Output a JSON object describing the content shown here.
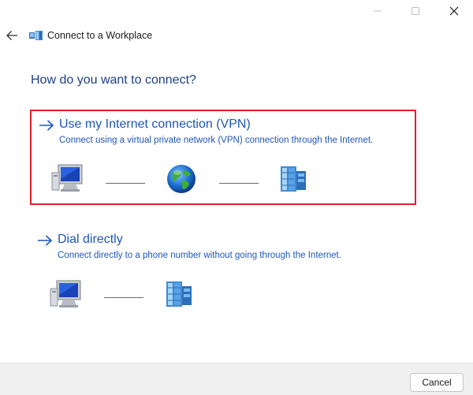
{
  "window": {
    "title": "Connect to a Workplace",
    "controls": [
      "minimize",
      "maximize",
      "close"
    ]
  },
  "header": {
    "back_icon": "back-arrow-icon",
    "app_icon": "workplace-network-icon",
    "title": "Connect to a Workplace"
  },
  "main": {
    "heading": "How do you want to connect?",
    "options": [
      {
        "title": "Use my Internet connection (VPN)",
        "description": "Connect using a virtual private network (VPN) connection through the Internet.",
        "icons": [
          "computer-icon",
          "globe-icon",
          "server-icon"
        ],
        "highlighted": true
      },
      {
        "title": "Dial directly",
        "description": "Connect directly to a phone number without going through the Internet.",
        "icons": [
          "computer-icon",
          "server-icon"
        ],
        "highlighted": false
      }
    ]
  },
  "footer": {
    "cancel_label": "Cancel"
  },
  "colors": {
    "heading": "#1e3f8a",
    "link": "#1f56b8",
    "highlight_border": "#e0202a",
    "footer_bg": "#f0f0f0"
  }
}
